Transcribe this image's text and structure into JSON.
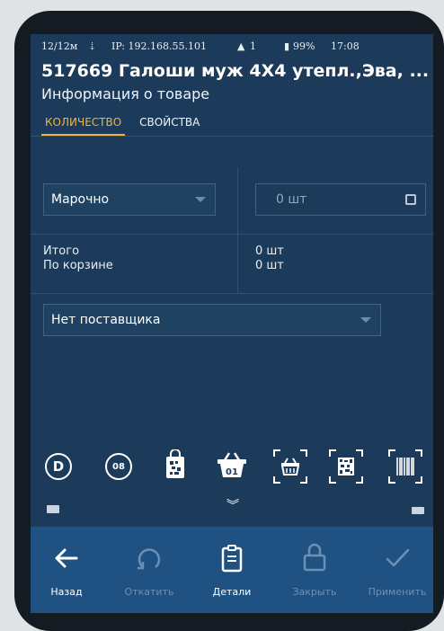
{
  "status_bar": {
    "counter": "12/12м",
    "ip": "IP: 192.168.55.101",
    "notifications": "1",
    "battery": "99%",
    "time": "17:08"
  },
  "header": {
    "title": "517669 Галоши муж 4X4 утепл.,Эва, ...",
    "subtitle": "Информация о товаре"
  },
  "tabs": [
    {
      "label": "Количество",
      "active": true
    },
    {
      "label": "Свойства",
      "active": false
    }
  ],
  "quantity": {
    "marking_select": "Марочно",
    "qty_value": "0 шт",
    "total_label": "Итого",
    "cart_label": "По корзине",
    "total_value": "0 шт",
    "cart_value": "0 шт",
    "supplier_select": "Нет поставщика"
  },
  "action_icons": [
    {
      "name": "d-icon",
      "text": "D"
    },
    {
      "name": "08-icon",
      "text": "08"
    },
    {
      "name": "bag-datamatrix-icon"
    },
    {
      "name": "basket-01-icon",
      "text": "01"
    },
    {
      "name": "basket-scan-icon"
    },
    {
      "name": "datamatrix-scan-icon"
    },
    {
      "name": "barcode-scan-icon"
    }
  ],
  "bottom_bar": [
    {
      "label": "Назад",
      "icon": "arrow-left-icon",
      "enabled": true
    },
    {
      "label": "Откатить",
      "icon": "undo-icon",
      "enabled": false
    },
    {
      "label": "Детали",
      "icon": "clipboard-icon",
      "enabled": true
    },
    {
      "label": "Закрыть",
      "icon": "lock-icon",
      "enabled": false
    },
    {
      "label": "Применить",
      "icon": "check-icon",
      "enabled": false
    }
  ],
  "colors": {
    "background": "#1c3b5a",
    "bottom_bar": "#1f5283",
    "accent": "#f2b23c"
  }
}
